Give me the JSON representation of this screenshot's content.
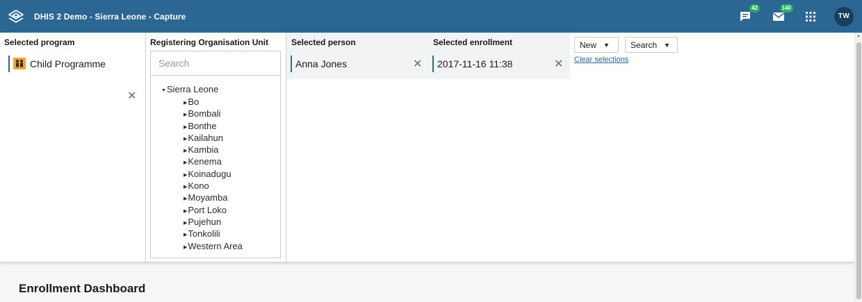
{
  "header": {
    "app_title": "DHIS 2 Demo - Sierra Leone - Capture",
    "messages_badge": "42",
    "mail_badge": "140",
    "avatar_initials": "TW",
    "bg_color": "#2c6693"
  },
  "selected_program": {
    "title": "Selected program",
    "value": "Child Programme",
    "icon": "children-icon"
  },
  "org_unit": {
    "title": "Registering Organisation Unit",
    "search_placeholder": "Search",
    "root": "Sierra Leone",
    "children": [
      "Bo",
      "Bombali",
      "Bonthe",
      "Kailahun",
      "Kambia",
      "Kenema",
      "Koinadugu",
      "Kono",
      "Moyamba",
      "Port Loko",
      "Pujehun",
      "Tonkolili",
      "Western Area"
    ]
  },
  "selected_person": {
    "title": "Selected person",
    "value": "Anna Jones"
  },
  "selected_enrollment": {
    "title": "Selected enrollment",
    "value": "2017-11-16 11:38"
  },
  "actions": {
    "new_label": "New",
    "search_label": "Search",
    "clear_label": "Clear selections"
  },
  "dashboard": {
    "title": "Enrollment Dashboard"
  }
}
